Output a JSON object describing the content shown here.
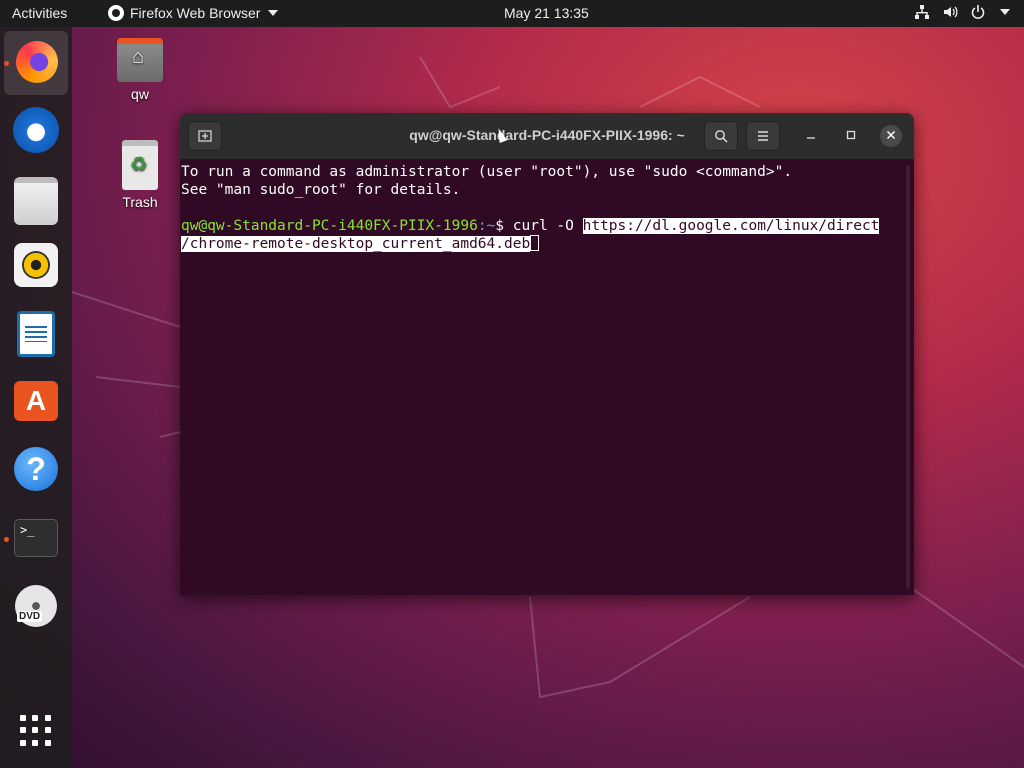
{
  "topbar": {
    "activities": "Activities",
    "app_name": "Firefox Web Browser",
    "clock": "May 21  13:35"
  },
  "dock": {
    "items": [
      {
        "name": "firefox",
        "running": true
      },
      {
        "name": "thunderbird",
        "running": false
      },
      {
        "name": "files",
        "running": false
      },
      {
        "name": "rhythmbox",
        "running": false
      },
      {
        "name": "libreoffice-writer",
        "running": false
      },
      {
        "name": "ubuntu-software",
        "running": false
      },
      {
        "name": "help",
        "running": false
      },
      {
        "name": "terminal",
        "running": true
      },
      {
        "name": "dvd",
        "running": false
      },
      {
        "name": "show-applications",
        "running": false
      }
    ],
    "terminal_glyph": ">_",
    "dvd_label": "DVD"
  },
  "desktop": {
    "home_label": "qw",
    "trash_label": "Trash"
  },
  "terminal": {
    "title": "qw@qw-Standard-PC-i440FX-PIIX-1996: ~",
    "line1": "To run a command as administrator (user \"root\"), use \"sudo <command>\".",
    "line2": "See \"man sudo_root\" for details.",
    "prompt_user": "qw@qw-Standard-PC-i440FX-PIIX-1996",
    "prompt_path": ":~",
    "prompt_symbol": "$ ",
    "command": "curl -O ",
    "selected_url_part1": "https://dl.google.com/linux/direct",
    "selected_url_part2": "/chrome-remote-desktop_current_amd64.deb"
  },
  "colors": {
    "terminal_bg": "#300a24",
    "prompt_user": "#8ae234",
    "prompt_path": "#729fcf",
    "accent": "#e95420"
  }
}
